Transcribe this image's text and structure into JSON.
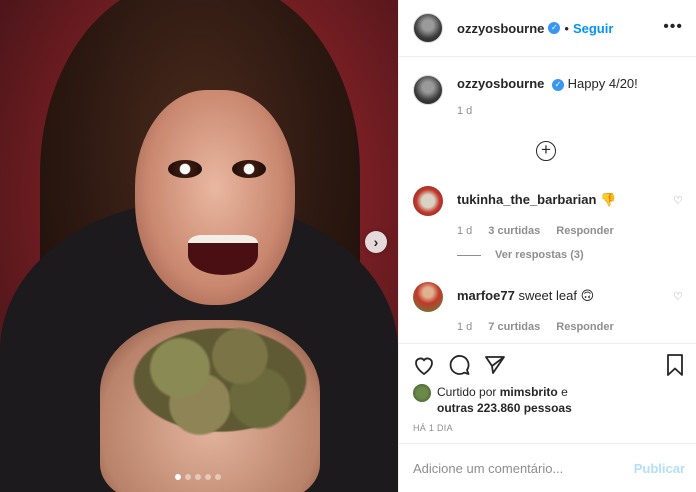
{
  "post": {
    "username": "ozzyosbourne",
    "separator": "•",
    "follow_label": "Seguir",
    "more_label": "•••",
    "caption_text": "Happy 4/20!",
    "caption_time": "1 d",
    "carousel": {
      "dot_count": 5,
      "active_index": 0
    }
  },
  "comments": [
    {
      "username": "tukinha_the_barbarian",
      "text": "",
      "emoji": "👎",
      "time": "1 d",
      "likes": "3 curtidas",
      "reply_label": "Responder",
      "view_replies": "Ver respostas (3)"
    },
    {
      "username": "marfoe77",
      "text": "sweet leaf",
      "emoji": "🙃",
      "time": "1 d",
      "likes": "7 curtidas",
      "reply_label": "Responder"
    }
  ],
  "likes": {
    "prefix": "Curtido por",
    "user": "mimsbrito",
    "conjunction": "e",
    "others": "outras 223.860 pessoas"
  },
  "post_age": "HÁ 1 DIA",
  "add_comment": {
    "placeholder": "Adicione um comentário...",
    "publish_label": "Publicar"
  },
  "icons": {
    "next": "chevron-right-icon",
    "load_more": "plus-circle-icon",
    "like": "heart-icon",
    "comment": "comment-icon",
    "share": "paper-plane-icon",
    "save": "bookmark-icon"
  },
  "colors": {
    "accent": "#0095f6",
    "muted": "#8e8e8e",
    "text": "#262626",
    "publish_disabled": "#b2dffc"
  }
}
